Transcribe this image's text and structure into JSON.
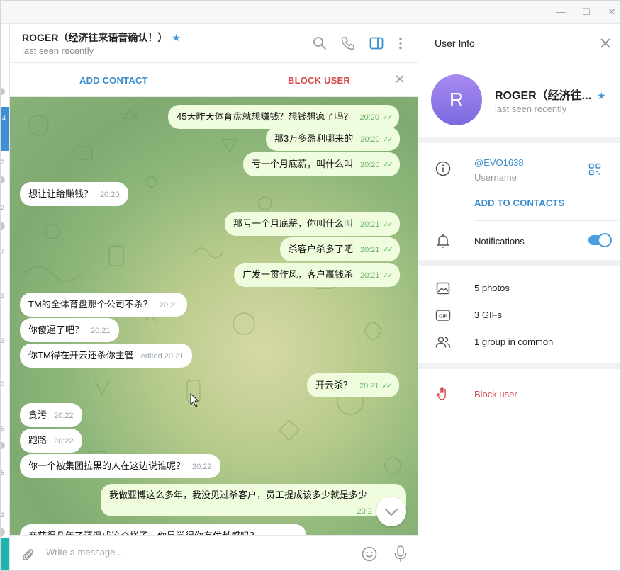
{
  "window": {
    "minimize_glyph": "—",
    "maximize_glyph": "☐",
    "close_glyph": "✕"
  },
  "left_strip": {
    "numbers": [
      "4",
      "2",
      "2",
      "7",
      "9",
      "3",
      "0",
      "5",
      "5",
      "2"
    ]
  },
  "chat": {
    "title": "ROGER（经济往来语音确认！）",
    "status": "last seen recently",
    "actions": {
      "add_contact": "ADD CONTACT",
      "block_user": "BLOCK USER"
    },
    "header_icons": [
      "search-icon",
      "phone-icon",
      "sidebar-toggle-icon",
      "more-vertical-icon"
    ],
    "messages": [
      {
        "dir": "out",
        "text": "45天昨天体育盘就想赚钱？想钱想疯了吗？",
        "time": "20:20",
        "read": true
      },
      {
        "dir": "out",
        "text": "那3万多盈利哪来的",
        "time": "20:20",
        "read": true
      },
      {
        "dir": "out",
        "text": "亏一个月底薪，叫什么叫",
        "time": "20:20",
        "read": true
      },
      {
        "dir": "in",
        "text": "想让让给赚钱？",
        "time": "20:20"
      },
      {
        "dir": "out",
        "text": "那亏一个月底薪，你叫什么叫",
        "time": "20:21",
        "read": true
      },
      {
        "dir": "out",
        "text": "杀客户杀多了吧",
        "time": "20:21",
        "read": true
      },
      {
        "dir": "out",
        "text": "广发一贯作风，客户赢钱杀",
        "time": "20:21",
        "read": true
      },
      {
        "dir": "in",
        "text": "TM的全体育盘那个公司不杀？",
        "time": "20:21"
      },
      {
        "dir": "in",
        "text": "你傻逼了吧？",
        "time": "20:21"
      },
      {
        "dir": "in",
        "text": "你TM得在开云还杀你主管",
        "time": "edited 20:21"
      },
      {
        "dir": "out",
        "text": "开云杀？",
        "time": "20:21",
        "read": true
      },
      {
        "dir": "in",
        "text": "贪污",
        "time": "20:22"
      },
      {
        "dir": "in",
        "text": "跑路",
        "time": "20:22"
      },
      {
        "dir": "in",
        "text": "你一个被集团拉黑的人在这边说谁呢？",
        "time": "20:22"
      },
      {
        "dir": "out",
        "text": "我做亚博这么多年，我没见过杀客户，员工提成该多少就是多少",
        "time": "20:2",
        "read": false
      }
    ],
    "partial_message": "亲获得几年了还混成这个样子，你是觉得你有优越感吗？",
    "composer_placeholder": "Write a message..."
  },
  "info": {
    "title": "User Info",
    "avatar_letter": "R",
    "name": "ROGER（经济往...",
    "status": "last seen recently",
    "username": "@EVO1638",
    "username_label": "Username",
    "add_to_contacts": "ADD TO CONTACTS",
    "notifications_label": "Notifications",
    "notifications_on": true,
    "photos": "5 photos",
    "gifs": "3 GIFs",
    "gif_badge": "GIF",
    "groups": "1 group in common",
    "block": "Block user"
  },
  "colors": {
    "accent": "#3a8ccc",
    "danger": "#d44a4a",
    "outgoing_bubble": "#effdde",
    "incoming_bubble": "#ffffff",
    "avatar": "#8f7be8",
    "star": "#3a9be3"
  }
}
